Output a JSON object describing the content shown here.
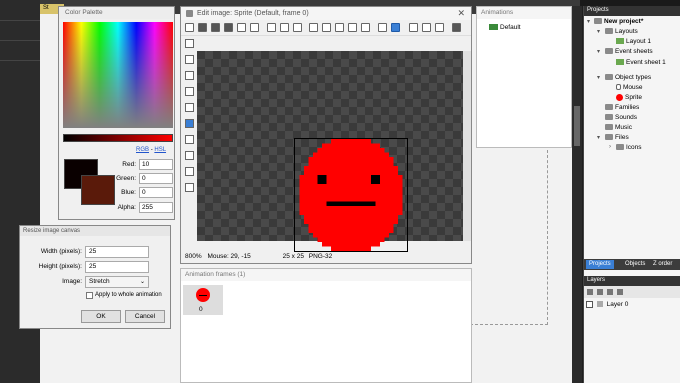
{
  "background": {
    "tab_label": "St"
  },
  "palette": {
    "title": "Color Palette",
    "rgb_link": "RGB",
    "separator": "-",
    "hsl_link": "HSL",
    "fields": [
      {
        "label": "Red:",
        "value": "10"
      },
      {
        "label": "Green:",
        "value": "0"
      },
      {
        "label": "Blue:",
        "value": "0"
      },
      {
        "label": "Alpha:",
        "value": "255"
      }
    ],
    "primary_color": "#0a0000",
    "secondary_color": "#5a1a0a"
  },
  "resize": {
    "title": "Resize image canvas",
    "width_label": "Width (pixels):",
    "width_value": "25",
    "height_label": "Height (pixels):",
    "height_value": "25",
    "image_label": "Image:",
    "image_value": "Stretch",
    "apply_label": "Apply to whole animation",
    "ok_label": "OK",
    "cancel_label": "Cancel"
  },
  "editor": {
    "title": "Edit image: Sprite (Default, frame 0)",
    "status_zoom": "800%",
    "status_mouse": "Mouse: 29, -15",
    "status_size": "25 x 25",
    "status_format": "PNG-32",
    "sprite_color": "#ff0000"
  },
  "animations": {
    "header": "Animations",
    "items": [
      "Default"
    ]
  },
  "frames": {
    "header": "Animation frames (1)",
    "frame_number": "0"
  },
  "projects": {
    "header": "Projects",
    "tree": [
      {
        "label": "New project*",
        "icon": "project-icon"
      },
      {
        "label": "Layouts",
        "icon": "folder-icon"
      },
      {
        "label": "Layout 1",
        "icon": "layout-icon"
      },
      {
        "label": "Event sheets",
        "icon": "folder-icon"
      },
      {
        "label": "Event sheet 1",
        "icon": "event-sheet-icon"
      },
      {
        "label": "Object types",
        "icon": "folder-icon"
      },
      {
        "label": "Mouse",
        "icon": "mouse-icon"
      },
      {
        "label": "Sprite",
        "icon": "sprite-icon"
      },
      {
        "label": "Families",
        "icon": "folder-icon"
      },
      {
        "label": "Sounds",
        "icon": "folder-icon"
      },
      {
        "label": "Music",
        "icon": "folder-icon"
      },
      {
        "label": "Files",
        "icon": "folder-icon"
      },
      {
        "label": "Icons",
        "icon": "folder-icon"
      }
    ],
    "tabs": [
      "Projects",
      "Objects",
      "Z order"
    ],
    "layers_header": "Layers",
    "layer_name": "Layer 0"
  }
}
